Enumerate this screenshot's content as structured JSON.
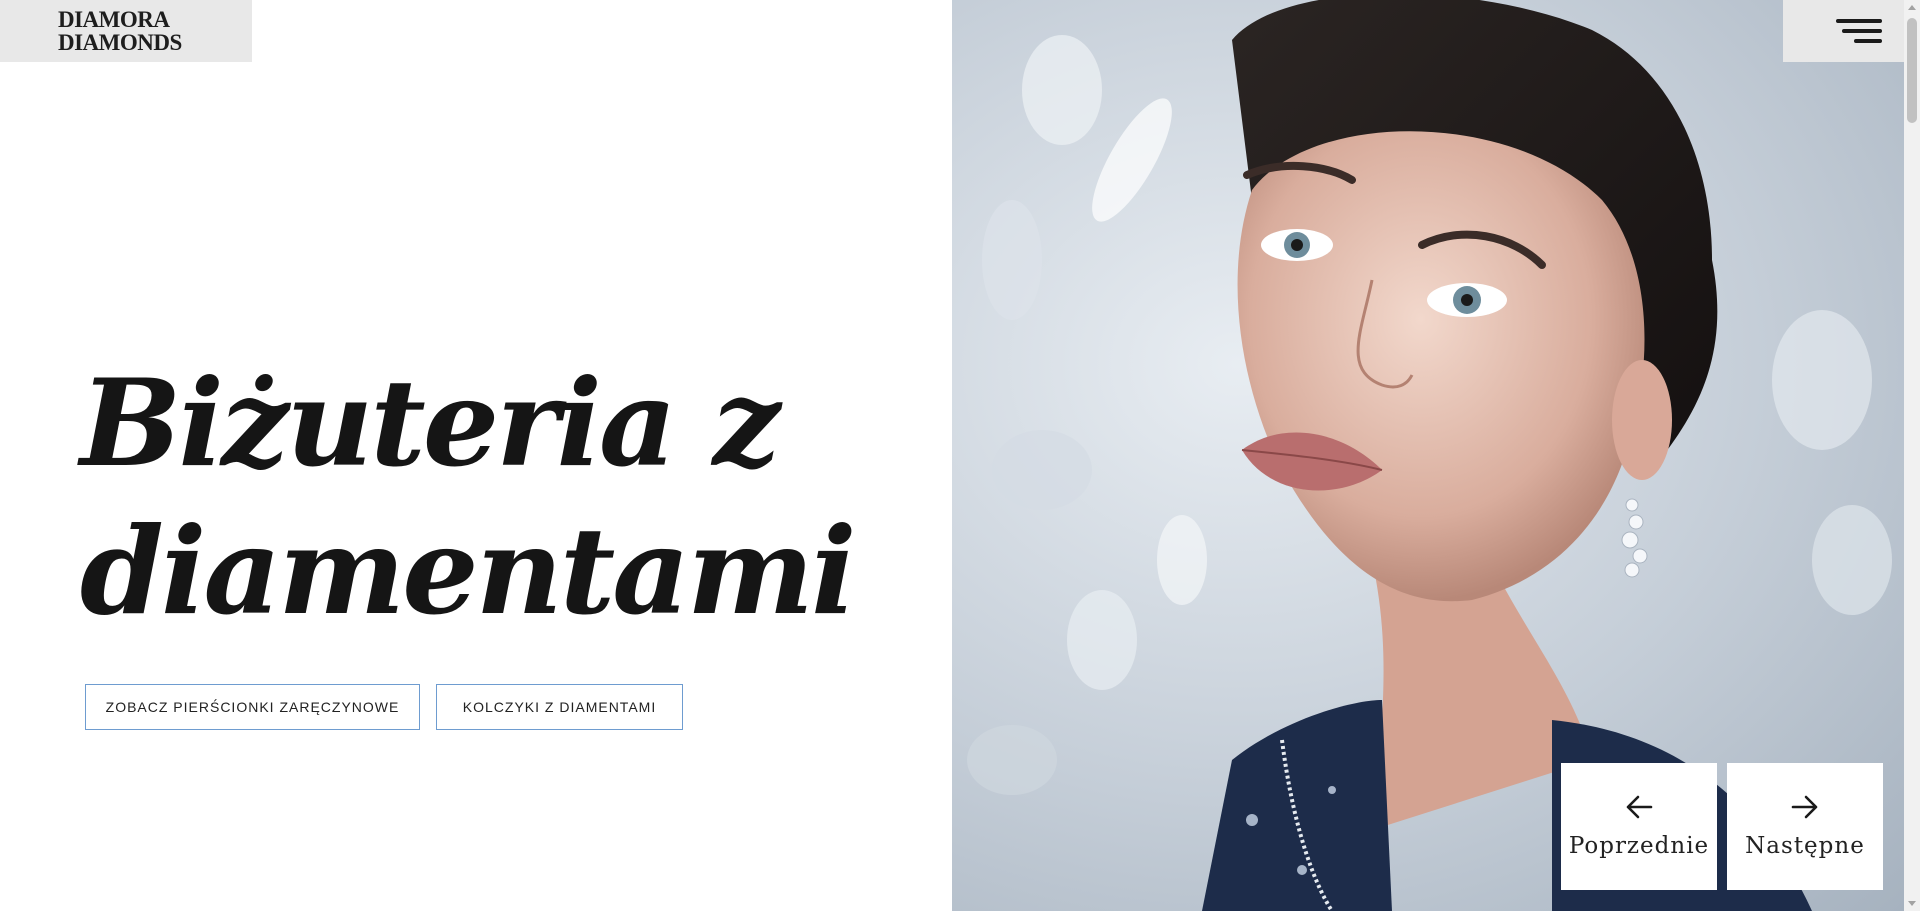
{
  "brand": {
    "line1": "DIAMORA",
    "line2": "DIAMONDS"
  },
  "hero": {
    "heading_line1": "Biżuteria z",
    "heading_line2": "diamentami",
    "primary_cta": "ZOBACZ PIERŚCIONKI ZARĘCZYNOWE",
    "secondary_cta": "KOLCZYKI Z DIAMENTAMI"
  },
  "slider": {
    "prev_label": "Poprzednie",
    "next_label": "Następne"
  },
  "icons": {
    "menu": "hamburger-menu-icon",
    "prev": "arrow-left-icon",
    "next": "arrow-right-icon"
  },
  "colors": {
    "button_border": "#6e9cd0",
    "header_box": "#e8e8e8",
    "text": "#151515"
  }
}
